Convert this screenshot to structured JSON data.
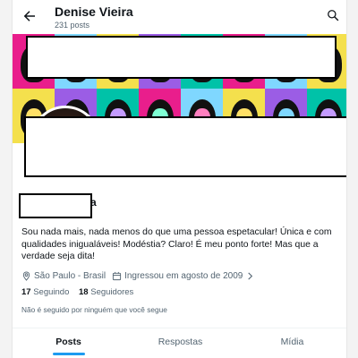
{
  "header": {
    "back_icon": "arrow-left-icon",
    "title": "Denise Vieira",
    "subtitle": "231 posts",
    "search_icon": "search-icon"
  },
  "profile": {
    "name_visible_suffix": "a",
    "bio": "Sou nada mais, nada menos do que uma pessoa espetacular! Única e com qualidades inigualáveis! Modéstia? Claro! É meu ponto forte! Mas que a verdade seja dita!",
    "location": "São Paulo - Brasil",
    "location_icon": "location-pin-icon",
    "joined": "Ingressou em agosto de 2009",
    "joined_icon": "calendar-icon",
    "joined_chevron": "chevron-right-icon",
    "following_count": "17",
    "following_label": "Seguindo",
    "followers_count": "18",
    "followers_label": "Seguidores",
    "followed_by": "Não é seguido por ninguém que você segue"
  },
  "tabs": [
    {
      "label": "Posts",
      "active": true
    },
    {
      "label": "Respostas",
      "active": false
    },
    {
      "label": "Mídia",
      "active": false
    }
  ],
  "colors": {
    "accent": "#1d9bf0",
    "text": "#0f1419",
    "muted": "#536471",
    "banner": [
      "#e91e8c",
      "#7fd7ff",
      "#f4e04d",
      "#9b5de5",
      "#00c2a8"
    ]
  }
}
